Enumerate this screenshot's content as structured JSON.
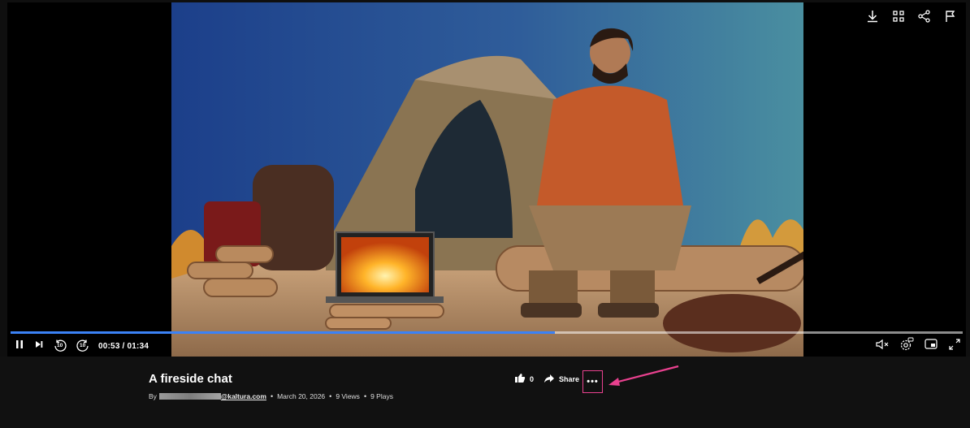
{
  "player": {
    "progress": 0.572,
    "time_label": "00:53 / 01:34",
    "skip_back_label": "10",
    "skip_forward_label": "10",
    "icons": [
      "download-icon",
      "grid-icon",
      "share-icon",
      "flag-icon",
      "pause-icon",
      "next-icon",
      "rewind-10-icon",
      "forward-10-icon",
      "mute-icon",
      "settings-icon",
      "pip-icon",
      "fullscreen-icon"
    ],
    "accent": "#3b82f6"
  },
  "media": {
    "title": "A fireside chat",
    "by_prefix": "By",
    "author_email_suffix": "@kaltura.com",
    "date": "March 20, 2026",
    "views": "9 Views",
    "plays": "9 Plays",
    "separator": "•"
  },
  "actions": {
    "like_count": "0",
    "share_label": "Share",
    "more_label": "•••"
  },
  "annotation": {
    "highlight_color": "#e9418f"
  }
}
